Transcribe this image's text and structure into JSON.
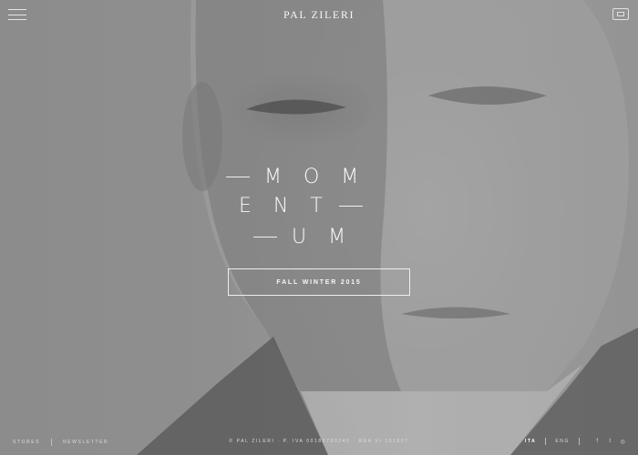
{
  "header": {
    "brand": "PAL ZILERI",
    "menu_icon": "hamburger-menu-icon",
    "cart_icon": "shopping-bag-icon"
  },
  "hero": {
    "title_lines": [
      "MOM",
      "ENT",
      "UM"
    ],
    "cta_label": "FALL WINTER 2015"
  },
  "footer": {
    "left_links": [
      "STORES",
      "NEWSLETTER"
    ],
    "copyright": "© PAL ZILERI · P. IVA 00182780245 · REA VI 151507",
    "languages": [
      "ITA",
      "ENG"
    ],
    "active_language": "ITA",
    "social_icons": [
      "facebook-icon",
      "twitter-icon",
      "instagram-icon"
    ]
  },
  "colors": {
    "background": "#8f8f8f",
    "text": "#f2f2f2"
  }
}
